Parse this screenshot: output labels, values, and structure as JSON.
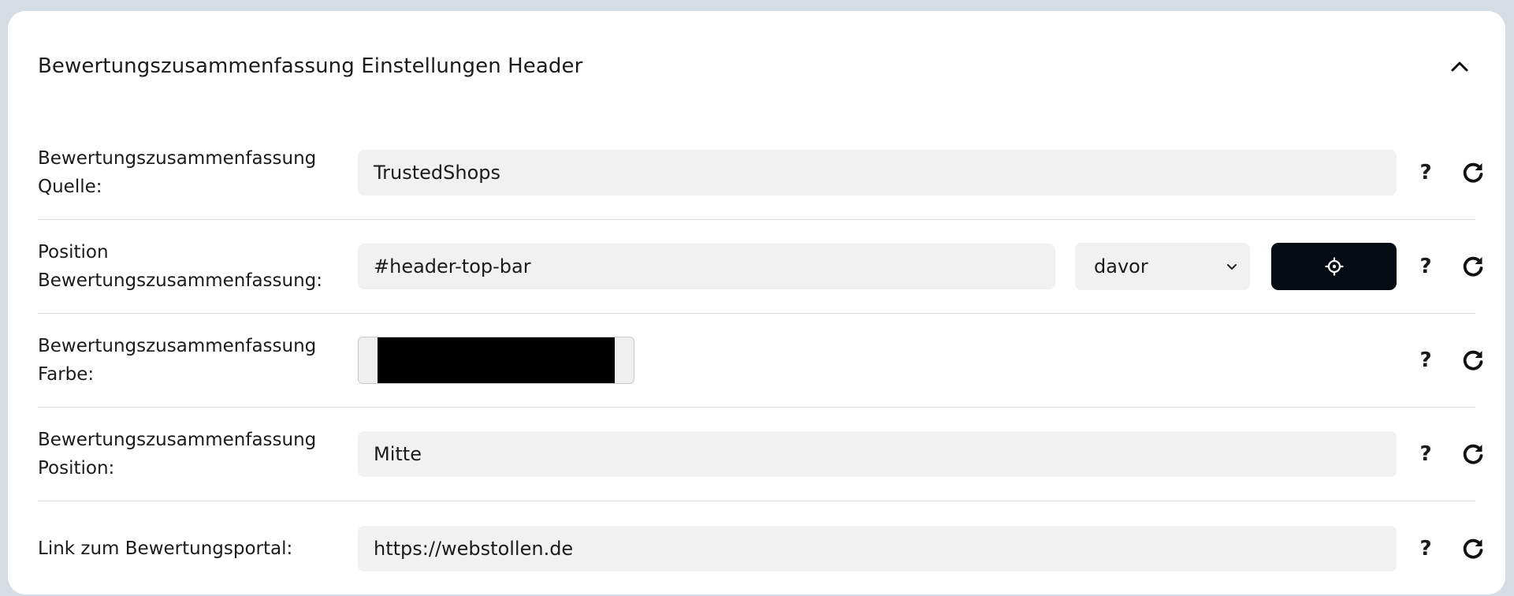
{
  "section": {
    "title": "Bewertungszusammenfassung Einstellungen Header",
    "collapse_icon": "chevron-up-icon"
  },
  "rows": [
    {
      "label_line1": "Bewertungszusammenfassung",
      "label_line2": "Quelle:",
      "value": "TrustedShops"
    },
    {
      "label_line1": "Position",
      "label_line2": "Bewertungszusammenfassung:",
      "value": "#header-top-bar",
      "select_value": "davor",
      "picker_icon": "crosshair-icon"
    },
    {
      "label_line1": "Bewertungszusammenfassung",
      "label_line2": "Farbe:",
      "color_value": "#000000"
    },
    {
      "label_line1": "Bewertungszusammenfassung",
      "label_line2": "Position:",
      "value": "Mitte"
    },
    {
      "label": "Link zum Bewertungsportal:",
      "value": "https://webstollen.de"
    }
  ],
  "help_text": "?",
  "reset_icon": "redo-icon",
  "colors": {
    "page_background": "#d3dde3",
    "card_background": "#ffffff",
    "field_background": "#f1f1f1",
    "picker_button_background": "#050c13"
  }
}
